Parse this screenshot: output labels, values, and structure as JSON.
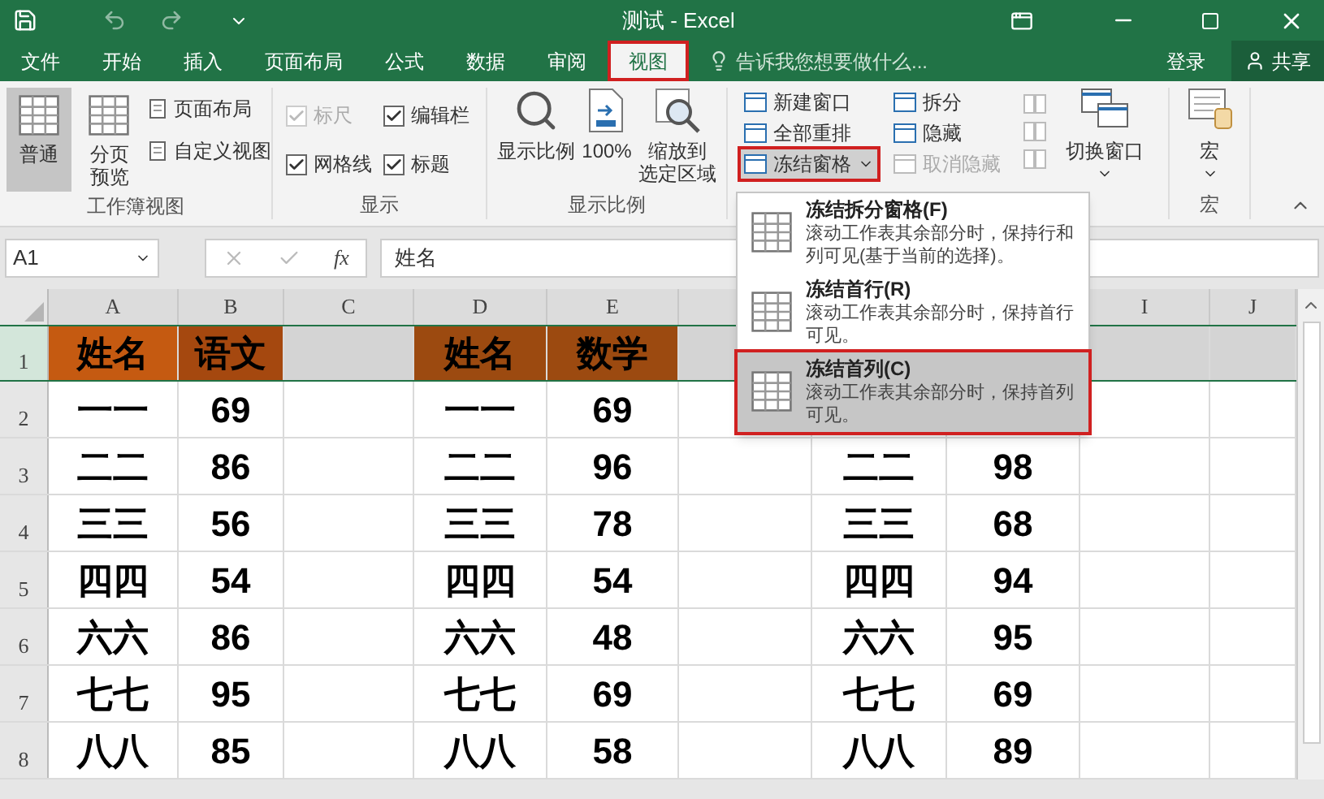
{
  "title_bar": {
    "title": "测试 - Excel"
  },
  "tabs": [
    {
      "label": "文件",
      "selected": false,
      "annotated": false
    },
    {
      "label": "开始",
      "selected": false,
      "annotated": false
    },
    {
      "label": "插入",
      "selected": false,
      "annotated": false
    },
    {
      "label": "页面布局",
      "selected": false,
      "annotated": false
    },
    {
      "label": "公式",
      "selected": false,
      "annotated": false
    },
    {
      "label": "数据",
      "selected": false,
      "annotated": false
    },
    {
      "label": "审阅",
      "selected": false,
      "annotated": false
    },
    {
      "label": "视图",
      "selected": true,
      "annotated": true
    }
  ],
  "search": {
    "placeholder": "告诉我您想要做什么..."
  },
  "account": {
    "sign_in": "登录",
    "share": "共享"
  },
  "workbook_views": {
    "label": "工作簿视图",
    "large": [
      {
        "label": "普通",
        "selected": true
      },
      {
        "label": "分页预览",
        "selected": false
      }
    ],
    "small": [
      "页面布局",
      "自定义视图"
    ]
  },
  "show": {
    "label": "显示",
    "checkboxes": [
      {
        "label": "标尺",
        "checked": true,
        "disabled": true
      },
      {
        "label": "编辑栏",
        "checked": true,
        "disabled": false
      },
      {
        "label": "网格线",
        "checked": true,
        "disabled": false
      },
      {
        "label": "标题",
        "checked": true,
        "disabled": false
      }
    ]
  },
  "zoom": {
    "label": "显示比例",
    "buttons": [
      {
        "kind": "magnifier",
        "lines": [
          "显示比例"
        ]
      },
      {
        "kind": "page",
        "lines": [
          "100%"
        ]
      },
      {
        "kind": "selection",
        "lines": [
          "缩放到",
          "选定区域"
        ]
      }
    ]
  },
  "window": {
    "columns": [
      [
        {
          "label": "新建窗口",
          "disabled": false,
          "annotated": false,
          "dropdown": false
        },
        {
          "label": "全部重排",
          "disabled": false,
          "annotated": false,
          "dropdown": false
        },
        {
          "label": "冻结窗格",
          "disabled": false,
          "annotated": true,
          "dropdown": true
        }
      ],
      [
        {
          "label": "拆分",
          "disabled": false,
          "annotated": false,
          "dropdown": false
        },
        {
          "label": "隐藏",
          "disabled": false,
          "annotated": false,
          "dropdown": false
        },
        {
          "label": "取消隐藏",
          "disabled": true,
          "annotated": false,
          "dropdown": false
        }
      ]
    ],
    "switch": "切换窗口"
  },
  "macros": {
    "label": "宏",
    "button": "宏"
  },
  "formula_bar": {
    "name_box": "A1",
    "fx": "fx",
    "value": "姓名"
  },
  "sheet": {
    "columns": [
      {
        "label": "A"
      },
      {
        "label": "B"
      },
      {
        "label": "C"
      },
      {
        "label": "D"
      },
      {
        "label": "E"
      },
      {},
      {},
      {},
      {
        "label": "I"
      },
      {
        "label": "J"
      }
    ],
    "rows": [
      {
        "number": "1",
        "selected": true,
        "a": {
          "text": "姓名",
          "color": "#c55a11"
        },
        "b": {
          "text": "语文",
          "color": "#a5480f"
        },
        "d": {
          "text": "姓名",
          "color": "#9c4a10"
        },
        "e": {
          "text": "数学",
          "color": "#9c4a10"
        }
      },
      {
        "number": "2",
        "selected": false,
        "a": {
          "text": "一一"
        },
        "b": {
          "text": "69"
        },
        "d": {
          "text": "一一"
        },
        "e": {
          "text": "69"
        }
      },
      {
        "number": "3",
        "selected": false,
        "a": {
          "text": "二二"
        },
        "b": {
          "text": "86"
        },
        "d": {
          "text": "二二"
        },
        "e": {
          "text": "96"
        },
        "g": {
          "text": "二二"
        },
        "h": {
          "text": "98"
        }
      },
      {
        "number": "4",
        "selected": false,
        "a": {
          "text": "三三"
        },
        "b": {
          "text": "56"
        },
        "d": {
          "text": "三三"
        },
        "e": {
          "text": "78"
        },
        "g": {
          "text": "三三"
        },
        "h": {
          "text": "68"
        }
      },
      {
        "number": "5",
        "selected": false,
        "a": {
          "text": "四四"
        },
        "b": {
          "text": "54"
        },
        "d": {
          "text": "四四"
        },
        "e": {
          "text": "54"
        },
        "g": {
          "text": "四四"
        },
        "h": {
          "text": "94"
        }
      },
      {
        "number": "6",
        "selected": false,
        "a": {
          "text": "六六"
        },
        "b": {
          "text": "86"
        },
        "d": {
          "text": "六六"
        },
        "e": {
          "text": "48"
        },
        "g": {
          "text": "六六"
        },
        "h": {
          "text": "95"
        }
      },
      {
        "number": "7",
        "selected": false,
        "a": {
          "text": "七七"
        },
        "b": {
          "text": "95"
        },
        "d": {
          "text": "七七"
        },
        "e": {
          "text": "69"
        },
        "g": {
          "text": "七七"
        },
        "h": {
          "text": "69"
        }
      },
      {
        "number": "8",
        "selected": false,
        "a": {
          "text": "八八"
        },
        "b": {
          "text": "85"
        },
        "d": {
          "text": "八八"
        },
        "e": {
          "text": "58"
        },
        "g": {
          "text": "八八"
        },
        "h": {
          "text": "89"
        }
      }
    ]
  },
  "menu": {
    "items": [
      {
        "title": "冻结拆分窗格(F)",
        "description": "滚动工作表其余部分时，保持行和列可见(基于当前的选择)。",
        "selected": false,
        "annotated": false
      },
      {
        "title": "冻结首行(R)",
        "description": "滚动工作表其余部分时，保持首行可见。",
        "selected": false,
        "annotated": false
      },
      {
        "title": "冻结首列(C)",
        "description": "滚动工作表其余部分时，保持首列可见。",
        "selected": true,
        "annotated": true
      }
    ]
  }
}
